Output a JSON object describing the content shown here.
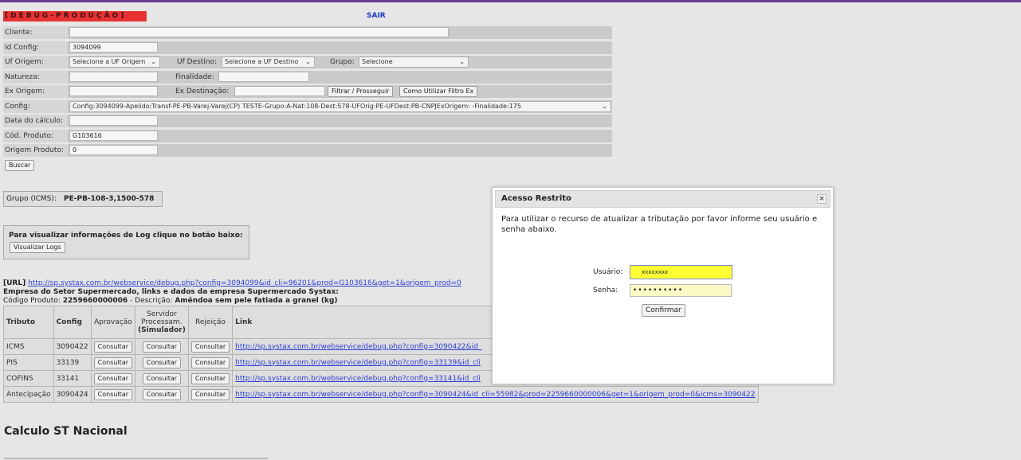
{
  "header": {
    "debug_label": "[DEBUG-PRODUÇÃO]",
    "sair": "SAIR"
  },
  "form": {
    "cliente_label": "Cliente:",
    "id_config_label": "Id Config:",
    "id_config_value": "3094099",
    "uf_origem_label": "Uf Origem:",
    "uf_origem_value": "Selecione a UF Origem",
    "uf_destino_label": "Uf Destino:",
    "uf_destino_value": "Selecione a UF Destino",
    "grupo_label": "Grupo:",
    "grupo_value": "Selecione",
    "natureza_label": "Natureza:",
    "finalidade_label": "Finalidade:",
    "ex_origem_label": "Ex Origem:",
    "ex_destinacao_label": "Ex Destinação:",
    "filtrar_button": "Filtrar / Prosseguir",
    "como_utilizar_button": "Como Utilizar Filtro Ex",
    "config_label": "Config:",
    "config_value": "Config:3094099-Apelido:Transf-PE-PB-Varej-Varej(CP) TESTE-Grupo:A-Nat:108-Dest:578-UFOrig:PE-UFDest:PB-CNPJExOrigem: -Finalidade:175",
    "data_calculo_label": "Data do cálculo:",
    "cod_produto_label": "Cód. Produto:",
    "cod_produto_value": "G103616",
    "origem_produto_label": "Origem Produto:",
    "origem_produto_value": "0",
    "buscar_button": "Buscar"
  },
  "grupo_box": {
    "label": "Grupo (ICMS):",
    "value": "PE-PB-108-3,1500-578"
  },
  "log_box": {
    "text": "Para visualizar informações de Log clique no botão baixo:",
    "button": "Visualizar Logs"
  },
  "url_block": {
    "url_tag": "[URL]",
    "url": "http://sp.systax.com.br/webservice/debug.php?config=3094099&id_cli=96201&prod=G103616&get=1&origem_prod=0",
    "empresa": "Empresa do Setor Supermercado, links e dados da empresa Supermercado Systax:",
    "codigo_label": "Código Produto:",
    "codigo_value": "2259660000006",
    "descricao_label": "- Descrição:",
    "descricao_value": "Amêndoa sem pele fatiada a granel (kg)"
  },
  "table": {
    "headers": {
      "tributo": "Tributo",
      "config": "Config",
      "aprovacao": "Aprovação",
      "servidor_1": "Servidor",
      "servidor_2": "Processam.",
      "servidor_3": "(Simulador)",
      "rejeicao": "Rejeição",
      "link": "Link"
    },
    "consultar": "Consultar",
    "rows": [
      {
        "tributo": "ICMS",
        "config": "3090422",
        "link": "http://sp.systax.com.br/webservice/debug.php?config=3090422&id_"
      },
      {
        "tributo": "PIS",
        "config": "33139",
        "link": "http://sp.systax.com.br/webservice/debug.php?config=33139&id_cli"
      },
      {
        "tributo": "COFINS",
        "config": "33141",
        "link": "http://sp.systax.com.br/webservice/debug.php?config=33141&id_cli"
      },
      {
        "tributo": "Antecipação",
        "config": "3090424",
        "link": "http://sp.systax.com.br/webservice/debug.php?config=3090424&id_cli=55982&prod=2259660000006&get=1&origem_prod=0&icms=3090422"
      }
    ]
  },
  "calc_title": "Calculo ST Nacional",
  "modal": {
    "title": "Acesso Restrito",
    "close": "×",
    "message": "Para utilizar o recurso de atualizar a tributação por favor informe seu usuário e senha abaixo.",
    "usuario_label": "Usuário:",
    "usuario_value": "xxxxxxxx",
    "senha_label": "Senha:",
    "senha_value": "••••••••••",
    "confirm_button": "Confirmar"
  },
  "colors": {
    "accent_bar": "#6a3c92",
    "debug_bg": "#e83232",
    "link": "#2b3fd6",
    "highlight_input": "#ffff33"
  }
}
